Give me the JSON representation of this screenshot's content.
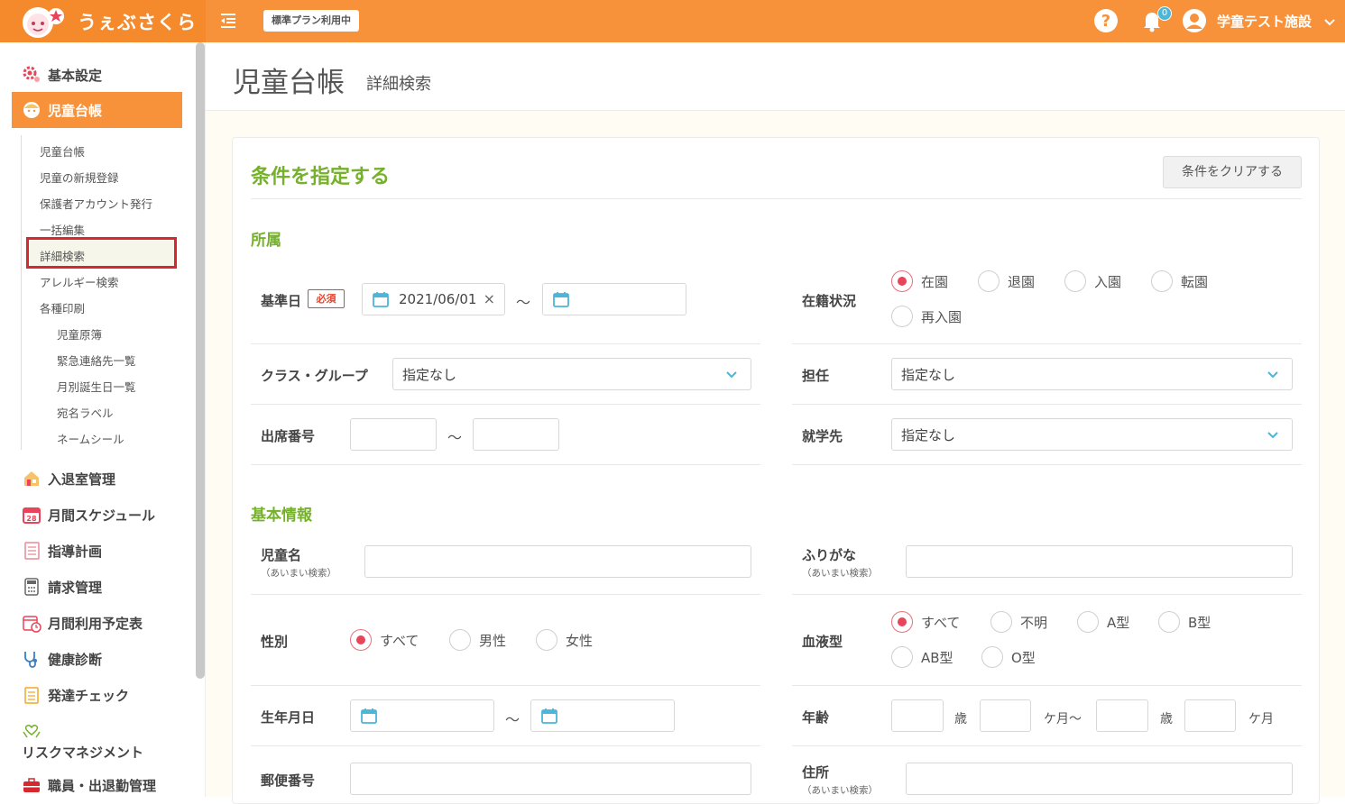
{
  "header": {
    "brand": "うぇぶさくら",
    "plan_badge": "標準プラン利用中",
    "notification_count": "0",
    "user_name": "学童テスト施設"
  },
  "sidebar": {
    "top_items": [
      {
        "label": "基本設定",
        "icon": "gear-icon"
      },
      {
        "label": "児童台帳",
        "icon": "child-face-icon"
      },
      {
        "label": "入退室管理",
        "icon": "house-icon"
      },
      {
        "label": "月間スケジュール",
        "icon": "calendar-28-icon"
      },
      {
        "label": "指導計画",
        "icon": "notebook-icon"
      },
      {
        "label": "請求管理",
        "icon": "calculator-icon"
      },
      {
        "label": "月間利用予定表",
        "icon": "calendar-clock-icon"
      },
      {
        "label": "健康診断",
        "icon": "stethoscope-icon"
      },
      {
        "label": "発達チェック",
        "icon": "checklist-icon"
      },
      {
        "label": "リスクマネジメント",
        "icon": "hands-heart-icon"
      },
      {
        "label": "職員・出退勤管理",
        "icon": "briefcase-icon"
      }
    ],
    "sub_items": [
      "児童台帳",
      "児童の新規登録",
      "保護者アカウント発行",
      "一括編集",
      "詳細検索",
      "アレルギー検索",
      "各種印刷"
    ],
    "print_items": [
      "児童原簿",
      "緊急連絡先一覧",
      "月別誕生日一覧",
      "宛名ラベル",
      "ネームシール"
    ]
  },
  "page": {
    "title": "児童台帳",
    "subtitle": "詳細検索"
  },
  "form": {
    "card_title": "条件を指定する",
    "clear_button": "条件をクリアする",
    "section_affiliation": "所属",
    "base_date_label": "基準日",
    "required_badge": "必須",
    "base_date_from": "2021/06/01",
    "base_date_clear": "×",
    "tilde": "〜",
    "enrollment_label": "在籍状況",
    "enrollment_options": [
      "在園",
      "退園",
      "入園",
      "転園",
      "再入園"
    ],
    "class_label": "クラス・グループ",
    "class_value": "指定なし",
    "teacher_label": "担任",
    "teacher_value": "指定なし",
    "attendance_no_label": "出席番号",
    "school_label": "就学先",
    "school_value": "指定なし",
    "section_basic": "基本情報",
    "child_name_label": "児童名",
    "fuzzy_note": "（あいまい検索）",
    "furigana_label": "ふりがな",
    "gender_label": "性別",
    "gender_options": [
      "すべて",
      "男性",
      "女性"
    ],
    "blood_label": "血液型",
    "blood_options": [
      "すべて",
      "不明",
      "A型",
      "B型",
      "AB型",
      "O型"
    ],
    "birthday_label": "生年月日",
    "age_label": "年齢",
    "age_units": [
      "歳",
      "ケ月〜",
      "歳",
      "ケ月"
    ],
    "postal_label": "郵便番号",
    "address_label": "住所"
  },
  "colors": {
    "accent": "#f7923a",
    "green": "#75b12a",
    "required": "#e1452e",
    "radio_on": "#e8445a"
  }
}
